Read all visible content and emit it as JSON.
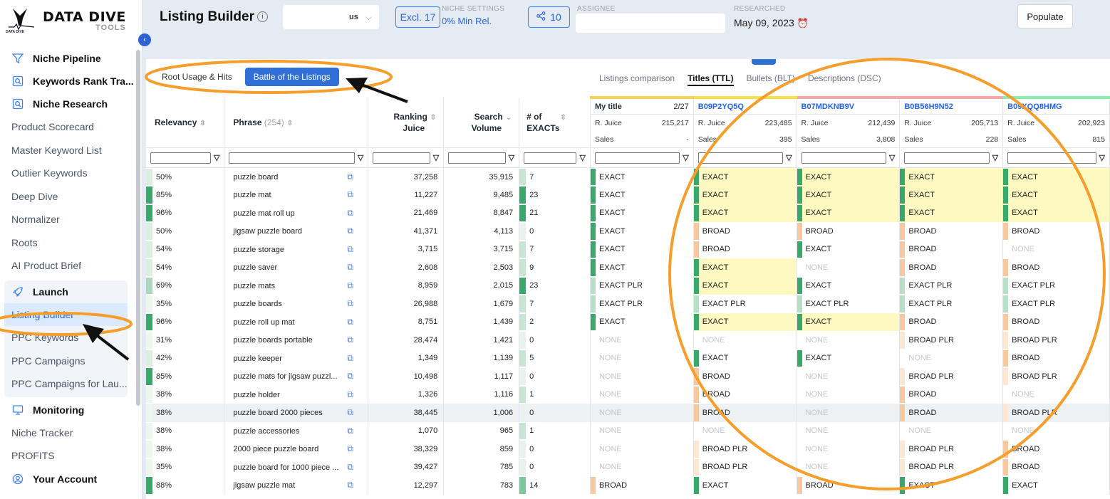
{
  "sidebar": {
    "logo_title": "DATA DIVE",
    "logo_sub": "TOOLS",
    "logo_small": "DATA DIVE",
    "items": [
      {
        "kind": "head",
        "label": "Niche Pipeline",
        "icon": "filter-icon"
      },
      {
        "kind": "head",
        "label": "Keywords Rank Tra...",
        "icon": "search-doc-icon"
      },
      {
        "kind": "head",
        "label": "Niche Research",
        "icon": "search-doc-icon"
      },
      {
        "kind": "sub",
        "label": "Product Scorecard"
      },
      {
        "kind": "sub",
        "label": "Master Keyword List"
      },
      {
        "kind": "sub",
        "label": "Outlier Keywords"
      },
      {
        "kind": "sub",
        "label": "Deep Dive"
      },
      {
        "kind": "sub",
        "label": "Normalizer"
      },
      {
        "kind": "sub",
        "label": "Roots"
      },
      {
        "kind": "sub",
        "label": "AI Product Brief"
      }
    ],
    "launch": {
      "label": "Launch",
      "icon": "rocket-icon",
      "items": [
        "Listing Builder",
        "PPC Keywords",
        "PPC Campaigns",
        "PPC Campaigns for Lau..."
      ],
      "active": "Listing Builder"
    },
    "monitoring": {
      "label": "Monitoring",
      "icon": "monitor-icon",
      "items": [
        "Niche Tracker",
        "PROFITS"
      ]
    },
    "account": {
      "label": "Your Account",
      "icon": "user-circle-icon"
    }
  },
  "topbar": {
    "title": "Listing Builder",
    "country": "us",
    "excl_label": "Excl. 17",
    "niche_settings_label": "NICHE SETTINGS",
    "niche_settings_value": "0% Min Rel.",
    "share_count": "10",
    "assignee_label": "ASSIGNEE",
    "researched_label": "RESEARCHED",
    "researched_date": "May 09, 2023",
    "populate_label": "Populate"
  },
  "tabs": {
    "segments": [
      "Root Usage & Hits",
      "Battle of the Listings"
    ],
    "active_segment": "Battle of the Listings",
    "views": [
      "Listings comparison",
      "Titles (TTL)",
      "Bullets (BLT)",
      "Descriptions (DSC)"
    ],
    "active_view": "Titles (TTL)"
  },
  "table": {
    "headers": {
      "relevancy": "Relevancy",
      "phrase": "Phrase",
      "phrase_count": "(254)",
      "ranking_juice_1": "Ranking",
      "ranking_juice_2": "Juice",
      "search_volume_1": "Search",
      "search_volume_2": "Volume",
      "exacts_1": "# of",
      "exacts_2": "EXACTs"
    },
    "listings": [
      {
        "title": "My title",
        "right": "2/27",
        "rjuice": "215,217",
        "sales": "-",
        "color": "#fbd24e"
      },
      {
        "title": "B09P2YQ5Q",
        "right": "",
        "rjuice": "223,485",
        "sales": "395",
        "color": "#fde047"
      },
      {
        "title": "B07MDKNB9V",
        "right": "",
        "rjuice": "212,439",
        "sales": "3,808",
        "color": "#f9a8a8"
      },
      {
        "title": "B0B56H9N52",
        "right": "",
        "rjuice": "205,713",
        "sales": "228",
        "color": "#fca5a5"
      },
      {
        "title": "B09XQQ8HMG",
        "right": "",
        "rjuice": "202,923",
        "sales": "815",
        "color": "#86efac"
      }
    ],
    "rjuice_label": "R. Juice",
    "sales_label": "Sales",
    "rows": [
      {
        "rel": "50%",
        "phrase": "puzzle board",
        "rj": "37,258",
        "sv": "35,915",
        "ex": "7",
        "ls": [
          "EXACT",
          "EXACT",
          "EXACT",
          "EXACT",
          "EXACT"
        ]
      },
      {
        "rel": "85%",
        "phrase": "puzzle mat",
        "rj": "11,227",
        "sv": "9,485",
        "ex": "23",
        "ls": [
          "EXACT",
          "EXACT",
          "EXACT",
          "EXACT",
          "EXACT"
        ]
      },
      {
        "rel": "96%",
        "phrase": "puzzle mat roll up",
        "rj": "21,469",
        "sv": "8,847",
        "ex": "21",
        "ls": [
          "EXACT",
          "EXACT",
          "EXACT",
          "EXACT",
          "EXACT"
        ]
      },
      {
        "rel": "50%",
        "phrase": "jigsaw puzzle board",
        "rj": "41,371",
        "sv": "4,113",
        "ex": "0",
        "ls": [
          "EXACT",
          "BROAD",
          "BROAD",
          "BROAD",
          "BROAD"
        ]
      },
      {
        "rel": "54%",
        "phrase": "puzzle storage",
        "rj": "3,715",
        "sv": "3,715",
        "ex": "7",
        "ls": [
          "EXACT",
          "BROAD",
          "EXACT",
          "BROAD",
          "NONE"
        ]
      },
      {
        "rel": "54%",
        "phrase": "puzzle saver",
        "rj": "2,608",
        "sv": "2,503",
        "ex": "9",
        "ls": [
          "EXACT",
          "EXACT",
          "NONE",
          "BROAD",
          "BROAD"
        ]
      },
      {
        "rel": "69%",
        "phrase": "puzzle mats",
        "rj": "8,959",
        "sv": "2,015",
        "ex": "23",
        "ls": [
          "EXACT PLR",
          "EXACT",
          "EXACT",
          "EXACT PLR",
          "EXACT PLR"
        ]
      },
      {
        "rel": "35%",
        "phrase": "puzzle boards",
        "rj": "26,988",
        "sv": "1,679",
        "ex": "7",
        "ls": [
          "EXACT PLR",
          "EXACT PLR",
          "EXACT PLR",
          "EXACT PLR",
          "EXACT PLR"
        ]
      },
      {
        "rel": "96%",
        "phrase": "puzzle roll up mat",
        "rj": "8,751",
        "sv": "1,439",
        "ex": "2",
        "ls": [
          "EXACT",
          "EXACT",
          "EXACT",
          "BROAD",
          "BROAD"
        ]
      },
      {
        "rel": "31%",
        "phrase": "puzzle boards portable",
        "rj": "28,474",
        "sv": "1,421",
        "ex": "0",
        "ls": [
          "NONE",
          "NONE",
          "NONE",
          "BROAD PLR",
          "BROAD PLR"
        ]
      },
      {
        "rel": "42%",
        "phrase": "puzzle keeper",
        "rj": "1,349",
        "sv": "1,139",
        "ex": "5",
        "ls": [
          "NONE",
          "EXACT",
          "EXACT",
          "NONE",
          "BROAD"
        ]
      },
      {
        "rel": "85%",
        "phrase": "puzzle mats for jigsaw puzzl...",
        "rj": "10,498",
        "sv": "1,117",
        "ex": "0",
        "ls": [
          "NONE",
          "BROAD",
          "NONE",
          "BROAD PLR",
          "BROAD PLR"
        ]
      },
      {
        "rel": "38%",
        "phrase": "puzzle holder",
        "rj": "1,326",
        "sv": "1,116",
        "ex": "1",
        "ls": [
          "NONE",
          "BROAD",
          "NONE",
          "BROAD",
          "NONE"
        ]
      },
      {
        "rel": "38%",
        "phrase": "puzzle board 2000 pieces",
        "rj": "38,445",
        "sv": "1,006",
        "ex": "0",
        "ls": [
          "NONE",
          "BROAD",
          "NONE",
          "BROAD",
          "BROAD PLR"
        ]
      },
      {
        "rel": "38%",
        "phrase": "puzzle accessories",
        "rj": "1,070",
        "sv": "965",
        "ex": "1",
        "ls": [
          "NONE",
          "NONE",
          "NONE",
          "NONE",
          "NONE"
        ]
      },
      {
        "rel": "38%",
        "phrase": "2000 piece puzzle board",
        "rj": "38,329",
        "sv": "859",
        "ex": "0",
        "ls": [
          "NONE",
          "BROAD PLR",
          "NONE",
          "BROAD PLR",
          "BROAD"
        ]
      },
      {
        "rel": "35%",
        "phrase": "puzzle board for 1000 piece ...",
        "rj": "39,427",
        "sv": "785",
        "ex": "0",
        "ls": [
          "NONE",
          "BROAD PLR",
          "NONE",
          "BROAD PLR",
          "BROAD"
        ]
      },
      {
        "rel": "88%",
        "phrase": "jigsaw puzzle mat",
        "rj": "12,297",
        "sv": "783",
        "ex": "14",
        "ls": [
          "BROAD",
          "EXACT",
          "BROAD",
          "EXACT",
          "EXACT"
        ]
      }
    ]
  },
  "colors": {
    "accent": "#2f6fd6",
    "exact_bar": "#3aa86b",
    "broad_bar": "#f6c9a0",
    "exact_plr_bar": "#b6e0c8",
    "broad_plr_bar": "#fde6d2",
    "highlight_yellow": "#fdf9c0",
    "annotation_orange": "#f59e2b",
    "annotation_arrow": "#111111"
  }
}
